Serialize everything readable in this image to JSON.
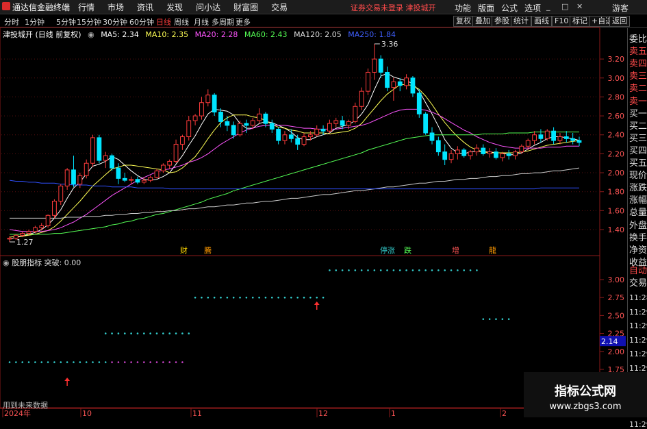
{
  "app": {
    "title": "通达信金融终端"
  },
  "menu": {
    "items": [
      "行情",
      "市场",
      "资讯",
      "发现",
      "问小达",
      "财富圈",
      "交易"
    ]
  },
  "login_status": "证券交易未登录  津投城开",
  "right_menu": [
    "功能",
    "版面",
    "公式",
    "选项"
  ],
  "window_buttons": [
    "_",
    "□",
    "✕"
  ],
  "guest_label": "游客",
  "periods": [
    "分时",
    "1分钟",
    "5分钟",
    "15分钟",
    "30分钟",
    "60分钟",
    "日线",
    "周线",
    "月线",
    "多周期",
    "更多"
  ],
  "active_period": "日线",
  "toolbar": [
    "复权",
    "叠加",
    "参股",
    "统计",
    "画线",
    "F10",
    "标记",
    "+自选",
    "返回"
  ],
  "main_panel": {
    "stock_label": "津投城开 (日线 前复权)",
    "ma_labels": [
      {
        "text": "MA5: 2.34",
        "color": "#ffffff"
      },
      {
        "text": "MA10: 2.35",
        "color": "#ffff55"
      },
      {
        "text": "MA20: 2.28",
        "color": "#ff55ff"
      },
      {
        "text": "MA60: 2.43",
        "color": "#55ff55"
      },
      {
        "text": "MA120: 2.05",
        "color": "#dddddd"
      },
      {
        "text": "MA250: 1.84",
        "color": "#4060ff"
      }
    ],
    "high_label": "3.36",
    "low_label": "1.27"
  },
  "sub_panel": {
    "indicator_label": "股朋指标",
    "value_label": "突破: 0.00",
    "current_value_box": "2.14"
  },
  "events": [
    {
      "text": "财",
      "color": "#ffd700"
    },
    {
      "text": "騰",
      "color": "#ff9900"
    },
    {
      "text": "停涨",
      "color": "#33cccc"
    },
    {
      "text": "跌",
      "color": "#55ff55"
    },
    {
      "text": "增",
      "color": "#ff5555"
    },
    {
      "text": "龍",
      "color": "#ff9900"
    }
  ],
  "sidebar": {
    "items": [
      "委比",
      "卖五",
      "卖四",
      "卖三",
      "卖二",
      "卖一",
      "买一",
      "买二",
      "买三",
      "买四",
      "买五",
      "现价",
      "涨跌",
      "涨幅",
      "总量",
      "外盘",
      "换手",
      "净资",
      "收益"
    ],
    "sub_items": [
      "自动",
      "交易"
    ],
    "times": [
      "11:28",
      "11:29",
      "11:29",
      "11:29",
      "11:29",
      "11:29",
      "11:29",
      "11:29",
      "11:29",
      "11:29"
    ]
  },
  "hint": "用到未来数据",
  "watermark": {
    "title": "指标公式网",
    "url": "www.zbgs3.com"
  },
  "colors": {
    "up": "#ff3c3c",
    "down": "#00e5ff",
    "background": "#000000",
    "grid": "#8b1a1a"
  },
  "chart_data": {
    "type": "candlestick",
    "price_axis": {
      "ticks": [
        3.2,
        3.0,
        2.8,
        2.6,
        2.4,
        2.2,
        2.0,
        1.8,
        1.6,
        1.4
      ],
      "range": [
        1.27,
        3.36
      ]
    },
    "sub_axis": {
      "ticks": [
        3.0,
        2.75,
        2.5,
        2.25,
        2.0,
        1.75
      ],
      "range": [
        1.7,
        3.1
      ]
    },
    "date_labels": [
      "2024年",
      "10",
      "11",
      "12",
      "1",
      "2"
    ],
    "candles": [
      [
        1.3,
        1.33,
        1.27,
        1.31
      ],
      [
        1.31,
        1.35,
        1.29,
        1.34
      ],
      [
        1.34,
        1.38,
        1.32,
        1.36
      ],
      [
        1.36,
        1.4,
        1.34,
        1.38
      ],
      [
        1.38,
        1.44,
        1.36,
        1.42
      ],
      [
        1.42,
        1.47,
        1.39,
        1.44
      ],
      [
        1.44,
        1.56,
        1.42,
        1.55
      ],
      [
        1.55,
        1.72,
        1.52,
        1.7
      ],
      [
        1.7,
        1.88,
        1.66,
        1.86
      ],
      [
        1.86,
        2.05,
        1.82,
        2.03
      ],
      [
        2.03,
        2.18,
        1.85,
        1.88
      ],
      [
        1.88,
        2.0,
        1.84,
        1.97
      ],
      [
        1.97,
        2.14,
        1.94,
        2.1
      ],
      [
        2.1,
        2.4,
        2.06,
        2.37
      ],
      [
        2.37,
        2.4,
        2.1,
        2.13
      ],
      [
        2.13,
        2.22,
        2.05,
        2.18
      ],
      [
        2.18,
        2.2,
        2.02,
        2.05
      ],
      [
        2.05,
        2.1,
        1.88,
        1.94
      ],
      [
        1.94,
        2.0,
        1.9,
        1.92
      ],
      [
        1.92,
        1.96,
        1.88,
        1.93
      ],
      [
        1.93,
        1.96,
        1.88,
        1.9
      ],
      [
        1.9,
        1.95,
        1.88,
        1.92
      ],
      [
        1.92,
        1.97,
        1.9,
        1.95
      ],
      [
        1.95,
        2.04,
        1.94,
        2.02
      ],
      [
        2.02,
        2.1,
        2.0,
        2.08
      ],
      [
        2.08,
        2.14,
        2.04,
        2.12
      ],
      [
        2.12,
        2.35,
        2.1,
        2.3
      ],
      [
        2.3,
        2.4,
        2.24,
        2.38
      ],
      [
        2.38,
        2.6,
        2.34,
        2.55
      ],
      [
        2.55,
        2.62,
        2.5,
        2.6
      ],
      [
        2.6,
        2.8,
        2.56,
        2.74
      ],
      [
        2.74,
        2.88,
        2.7,
        2.82
      ],
      [
        2.82,
        2.84,
        2.6,
        2.64
      ],
      [
        2.64,
        2.68,
        2.48,
        2.54
      ],
      [
        2.54,
        2.6,
        2.44,
        2.5
      ],
      [
        2.5,
        2.54,
        2.36,
        2.4
      ],
      [
        2.4,
        2.55,
        2.38,
        2.52
      ],
      [
        2.52,
        2.56,
        2.42,
        2.5
      ],
      [
        2.5,
        2.58,
        2.46,
        2.55
      ],
      [
        2.55,
        2.68,
        2.52,
        2.62
      ],
      [
        2.62,
        2.64,
        2.48,
        2.52
      ],
      [
        2.52,
        2.56,
        2.42,
        2.46
      ],
      [
        2.46,
        2.48,
        2.3,
        2.34
      ],
      [
        2.34,
        2.44,
        2.3,
        2.4
      ],
      [
        2.4,
        2.46,
        2.32,
        2.36
      ],
      [
        2.36,
        2.4,
        2.24,
        2.3
      ],
      [
        2.3,
        2.42,
        2.28,
        2.38
      ],
      [
        2.38,
        2.44,
        2.34,
        2.4
      ],
      [
        2.4,
        2.5,
        2.38,
        2.46
      ],
      [
        2.46,
        2.5,
        2.4,
        2.44
      ],
      [
        2.44,
        2.56,
        2.42,
        2.52
      ],
      [
        2.52,
        2.58,
        2.48,
        2.55
      ],
      [
        2.55,
        2.6,
        2.46,
        2.5
      ],
      [
        2.5,
        2.56,
        2.46,
        2.54
      ],
      [
        2.54,
        2.74,
        2.52,
        2.7
      ],
      [
        2.7,
        2.9,
        2.66,
        2.86
      ],
      [
        2.86,
        3.1,
        2.82,
        3.06
      ],
      [
        3.06,
        3.36,
        2.98,
        3.2
      ],
      [
        3.2,
        3.24,
        3.0,
        3.06
      ],
      [
        3.06,
        3.12,
        2.86,
        2.9
      ],
      [
        2.9,
        3.0,
        2.76,
        2.96
      ],
      [
        2.96,
        3.0,
        2.86,
        2.92
      ],
      [
        2.92,
        3.04,
        2.88,
        3.0
      ],
      [
        3.0,
        3.02,
        2.8,
        2.84
      ],
      [
        2.84,
        2.88,
        2.58,
        2.62
      ],
      [
        2.62,
        2.64,
        2.4,
        2.42
      ],
      [
        2.42,
        2.48,
        2.3,
        2.34
      ],
      [
        2.34,
        2.38,
        2.18,
        2.22
      ],
      [
        2.22,
        2.3,
        2.08,
        2.14
      ],
      [
        2.14,
        2.24,
        2.1,
        2.2
      ],
      [
        2.2,
        2.28,
        2.14,
        2.24
      ],
      [
        2.24,
        2.26,
        2.16,
        2.18
      ],
      [
        2.18,
        2.24,
        2.14,
        2.22
      ],
      [
        2.22,
        2.3,
        2.18,
        2.26
      ],
      [
        2.26,
        2.3,
        2.18,
        2.2
      ],
      [
        2.2,
        2.26,
        2.16,
        2.22
      ],
      [
        2.22,
        2.26,
        2.14,
        2.16
      ],
      [
        2.16,
        2.22,
        2.12,
        2.2
      ],
      [
        2.2,
        2.24,
        2.14,
        2.18
      ],
      [
        2.18,
        2.24,
        2.14,
        2.22
      ],
      [
        2.22,
        2.3,
        2.2,
        2.28
      ],
      [
        2.28,
        2.36,
        2.24,
        2.34
      ],
      [
        2.34,
        2.44,
        2.3,
        2.4
      ],
      [
        2.4,
        2.46,
        2.32,
        2.36
      ],
      [
        2.36,
        2.46,
        2.34,
        2.44
      ],
      [
        2.44,
        2.48,
        2.3,
        2.34
      ],
      [
        2.34,
        2.42,
        2.3,
        2.38
      ],
      [
        2.38,
        2.44,
        2.32,
        2.36
      ],
      [
        2.36,
        2.42,
        2.3,
        2.34
      ],
      [
        2.34,
        2.38,
        2.28,
        2.32
      ]
    ],
    "ma_lines": {
      "MA5": [
        1.3,
        1.32,
        1.33,
        1.35,
        1.37,
        1.4,
        1.45,
        1.52,
        1.61,
        1.73,
        1.84,
        1.9,
        1.99,
        2.07,
        2.09,
        2.12,
        2.17,
        2.14,
        2.08,
        2.02,
        1.97,
        1.93,
        1.92,
        1.93,
        1.96,
        2.0,
        2.09,
        2.18,
        2.29,
        2.39,
        2.51,
        2.62,
        2.67,
        2.66,
        2.65,
        2.61,
        2.52,
        2.47,
        2.47,
        2.52,
        2.54,
        2.53,
        2.5,
        2.47,
        2.43,
        2.37,
        2.35,
        2.35,
        2.38,
        2.4,
        2.42,
        2.47,
        2.49,
        2.51,
        2.55,
        2.62,
        2.72,
        2.88,
        3.02,
        3.05,
        3.01,
        2.99,
        2.97,
        2.94,
        2.86,
        2.74,
        2.62,
        2.49,
        2.35,
        2.26,
        2.21,
        2.2,
        2.22,
        2.23,
        2.22,
        2.22,
        2.21,
        2.21,
        2.19,
        2.19,
        2.21,
        2.25,
        2.29,
        2.32,
        2.36,
        2.38,
        2.38,
        2.37,
        2.36,
        2.34
      ],
      "MA10": [
        1.32,
        1.33,
        1.33,
        1.34,
        1.35,
        1.37,
        1.39,
        1.43,
        1.49,
        1.56,
        1.63,
        1.7,
        1.78,
        1.86,
        1.92,
        1.98,
        2.04,
        2.06,
        2.08,
        2.08,
        2.07,
        2.06,
        2.05,
        2.04,
        2.03,
        2.0,
        2.01,
        2.05,
        2.11,
        2.17,
        2.26,
        2.36,
        2.45,
        2.53,
        2.58,
        2.61,
        2.61,
        2.61,
        2.59,
        2.58,
        2.55,
        2.51,
        2.48,
        2.47,
        2.45,
        2.44,
        2.42,
        2.42,
        2.42,
        2.42,
        2.41,
        2.42,
        2.43,
        2.44,
        2.47,
        2.52,
        2.6,
        2.68,
        2.76,
        2.83,
        2.88,
        2.93,
        2.93,
        2.92,
        2.88,
        2.81,
        2.72,
        2.62,
        2.53,
        2.45,
        2.38,
        2.32,
        2.27,
        2.24,
        2.22,
        2.21,
        2.21,
        2.21,
        2.21,
        2.21,
        2.22,
        2.23,
        2.25,
        2.27,
        2.29,
        2.3,
        2.31,
        2.32,
        2.33,
        2.34
      ],
      "MA20": [
        1.4,
        1.39,
        1.38,
        1.38,
        1.38,
        1.38,
        1.39,
        1.4,
        1.42,
        1.45,
        1.48,
        1.52,
        1.56,
        1.61,
        1.66,
        1.71,
        1.76,
        1.8,
        1.84,
        1.88,
        1.92,
        1.95,
        1.98,
        2.01,
        2.03,
        2.04,
        2.06,
        2.08,
        2.11,
        2.13,
        2.16,
        2.2,
        2.25,
        2.3,
        2.34,
        2.38,
        2.42,
        2.45,
        2.47,
        2.49,
        2.5,
        2.5,
        2.5,
        2.5,
        2.49,
        2.48,
        2.47,
        2.47,
        2.46,
        2.46,
        2.46,
        2.46,
        2.47,
        2.48,
        2.49,
        2.5,
        2.52,
        2.55,
        2.58,
        2.61,
        2.64,
        2.66,
        2.67,
        2.67,
        2.67,
        2.66,
        2.64,
        2.61,
        2.57,
        2.53,
        2.49,
        2.45,
        2.42,
        2.38,
        2.35,
        2.32,
        2.3,
        2.28,
        2.27,
        2.26,
        2.26,
        2.26,
        2.26,
        2.26,
        2.27,
        2.27,
        2.27,
        2.28,
        2.28,
        2.28
      ],
      "MA60": [
        1.35,
        1.35,
        1.35,
        1.35,
        1.35,
        1.35,
        1.35,
        1.36,
        1.36,
        1.37,
        1.38,
        1.39,
        1.4,
        1.41,
        1.42,
        1.43,
        1.45,
        1.46,
        1.48,
        1.49,
        1.51,
        1.52,
        1.54,
        1.56,
        1.57,
        1.59,
        1.61,
        1.63,
        1.65,
        1.67,
        1.69,
        1.72,
        1.74,
        1.76,
        1.78,
        1.81,
        1.83,
        1.85,
        1.87,
        1.89,
        1.91,
        1.93,
        1.95,
        1.97,
        1.99,
        2.01,
        2.03,
        2.05,
        2.07,
        2.09,
        2.11,
        2.13,
        2.15,
        2.17,
        2.19,
        2.21,
        2.24,
        2.26,
        2.28,
        2.3,
        2.32,
        2.34,
        2.36,
        2.37,
        2.38,
        2.39,
        2.4,
        2.4,
        2.4,
        2.4,
        2.4,
        2.4,
        2.4,
        2.4,
        2.41,
        2.41,
        2.41,
        2.41,
        2.42,
        2.42,
        2.42,
        2.42,
        2.43,
        2.43,
        2.43,
        2.43,
        2.43,
        2.43,
        2.43,
        2.43
      ],
      "MA120": [
        1.52,
        1.52,
        1.52,
        1.52,
        1.52,
        1.52,
        1.52,
        1.52,
        1.52,
        1.53,
        1.53,
        1.53,
        1.54,
        1.54,
        1.54,
        1.55,
        1.55,
        1.56,
        1.56,
        1.57,
        1.57,
        1.58,
        1.58,
        1.59,
        1.59,
        1.6,
        1.6,
        1.61,
        1.62,
        1.62,
        1.63,
        1.64,
        1.64,
        1.65,
        1.66,
        1.66,
        1.67,
        1.68,
        1.68,
        1.69,
        1.7,
        1.7,
        1.71,
        1.72,
        1.73,
        1.73,
        1.74,
        1.75,
        1.76,
        1.77,
        1.77,
        1.78,
        1.79,
        1.8,
        1.81,
        1.81,
        1.82,
        1.83,
        1.84,
        1.85,
        1.85,
        1.86,
        1.87,
        1.88,
        1.89,
        1.89,
        1.9,
        1.91,
        1.91,
        1.92,
        1.93,
        1.93,
        1.94,
        1.94,
        1.95,
        1.96,
        1.96,
        1.97,
        1.97,
        1.98,
        1.99,
        1.99,
        2.0,
        2.0,
        2.01,
        2.02,
        2.02,
        2.03,
        2.04,
        2.05
      ],
      "MA250": [
        1.92,
        1.91,
        1.91,
        1.9,
        1.9,
        1.89,
        1.89,
        1.89,
        1.88,
        1.88,
        1.87,
        1.87,
        1.87,
        1.86,
        1.86,
        1.86,
        1.85,
        1.85,
        1.85,
        1.85,
        1.84,
        1.84,
        1.84,
        1.84,
        1.84,
        1.83,
        1.83,
        1.83,
        1.83,
        1.83,
        1.83,
        1.83,
        1.83,
        1.83,
        1.83,
        1.83,
        1.83,
        1.83,
        1.83,
        1.83,
        1.83,
        1.83,
        1.83,
        1.83,
        1.83,
        1.83,
        1.83,
        1.83,
        1.83,
        1.83,
        1.83,
        1.83,
        1.83,
        1.83,
        1.83,
        1.83,
        1.83,
        1.83,
        1.83,
        1.83,
        1.83,
        1.83,
        1.83,
        1.83,
        1.83,
        1.83,
        1.83,
        1.83,
        1.83,
        1.83,
        1.83,
        1.83,
        1.83,
        1.83,
        1.83,
        1.83,
        1.83,
        1.83,
        1.83,
        1.83,
        1.83,
        1.83,
        1.83,
        1.84,
        1.84,
        1.84,
        1.84,
        1.84,
        1.84,
        1.84
      ]
    },
    "indicator_steps": [
      {
        "from": 0,
        "to": 15,
        "value": 1.85,
        "color": "#33cccc"
      },
      {
        "from": 16,
        "to": 27,
        "value": 1.85,
        "color": "#cc44cc"
      },
      {
        "from": 15,
        "to": 28,
        "value": 2.25,
        "color": "#33cccc"
      },
      {
        "from": 29,
        "to": 49,
        "value": 2.75,
        "color": "#33cccc"
      },
      {
        "from": 50,
        "to": 73,
        "value": 3.13,
        "color": "#33cccc"
      },
      {
        "from": 74,
        "to": 78,
        "value": 2.45,
        "color": "#33cccc"
      }
    ],
    "arrows": [
      9,
      48
    ]
  }
}
